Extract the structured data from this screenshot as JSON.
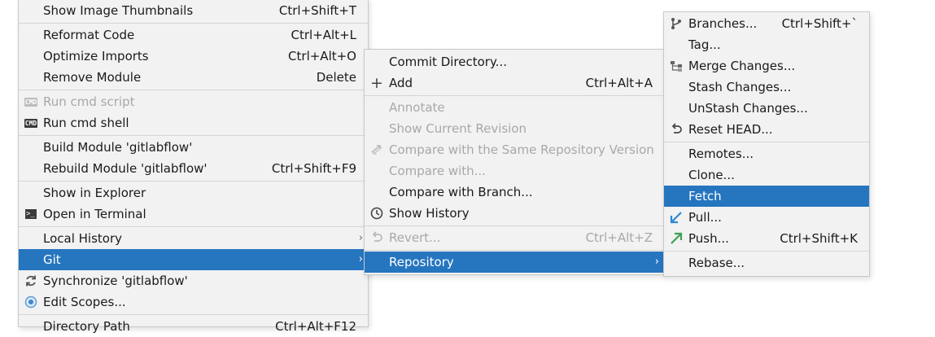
{
  "menu1": {
    "items": [
      {
        "label": "Show Image Thumbnails",
        "shortcut": "Ctrl+Shift+T"
      },
      {
        "label": "Reformat Code",
        "shortcut": "Ctrl+Alt+L"
      },
      {
        "label": "Optimize Imports",
        "shortcut": "Ctrl+Alt+O"
      },
      {
        "label": "Remove Module",
        "shortcut": "Delete"
      },
      {
        "label": "Run cmd script",
        "shortcut": ""
      },
      {
        "label": "Run cmd shell",
        "shortcut": ""
      },
      {
        "label": "Build Module 'gitlabflow'",
        "shortcut": ""
      },
      {
        "label": "Rebuild Module 'gitlabflow'",
        "shortcut": "Ctrl+Shift+F9"
      },
      {
        "label": "Show in Explorer",
        "shortcut": ""
      },
      {
        "label": "Open in Terminal",
        "shortcut": ""
      },
      {
        "label": "Local History",
        "shortcut": ""
      },
      {
        "label": "Git",
        "shortcut": ""
      },
      {
        "label": "Synchronize 'gitlabflow'",
        "shortcut": ""
      },
      {
        "label": "Edit Scopes...",
        "shortcut": ""
      },
      {
        "label": "Directory Path",
        "shortcut": "Ctrl+Alt+F12"
      }
    ]
  },
  "menu2": {
    "items": [
      {
        "label": "Commit Directory...",
        "shortcut": ""
      },
      {
        "label": "Add",
        "shortcut": "Ctrl+Alt+A"
      },
      {
        "label": "Annotate",
        "shortcut": ""
      },
      {
        "label": "Show Current Revision",
        "shortcut": ""
      },
      {
        "label": "Compare with the Same Repository Version",
        "shortcut": ""
      },
      {
        "label": "Compare with...",
        "shortcut": ""
      },
      {
        "label": "Compare with Branch...",
        "shortcut": ""
      },
      {
        "label": "Show History",
        "shortcut": ""
      },
      {
        "label": "Revert...",
        "shortcut": "Ctrl+Alt+Z"
      },
      {
        "label": "Repository",
        "shortcut": ""
      }
    ]
  },
  "menu3": {
    "items": [
      {
        "label": "Branches...",
        "shortcut": "Ctrl+Shift+`"
      },
      {
        "label": "Tag...",
        "shortcut": ""
      },
      {
        "label": "Merge Changes...",
        "shortcut": ""
      },
      {
        "label": "Stash Changes...",
        "shortcut": ""
      },
      {
        "label": "UnStash Changes...",
        "shortcut": ""
      },
      {
        "label": "Reset HEAD...",
        "shortcut": ""
      },
      {
        "label": "Remotes...",
        "shortcut": ""
      },
      {
        "label": "Clone...",
        "shortcut": ""
      },
      {
        "label": "Fetch",
        "shortcut": ""
      },
      {
        "label": "Pull...",
        "shortcut": ""
      },
      {
        "label": "Push...",
        "shortcut": "Ctrl+Shift+K"
      },
      {
        "label": "Rebase...",
        "shortcut": ""
      }
    ]
  },
  "icons": {
    "cmd_label": "CMD",
    "terminal_label": ">_",
    "add_glyph": "+",
    "submenu_arrow": "›"
  },
  "colors": {
    "menu_bg": "#f2f2f2",
    "selection": "#2675bf",
    "disabled_text": "#a8a8a8",
    "pull_arrow": "#2e86d6",
    "push_arrow": "#3aa055"
  }
}
